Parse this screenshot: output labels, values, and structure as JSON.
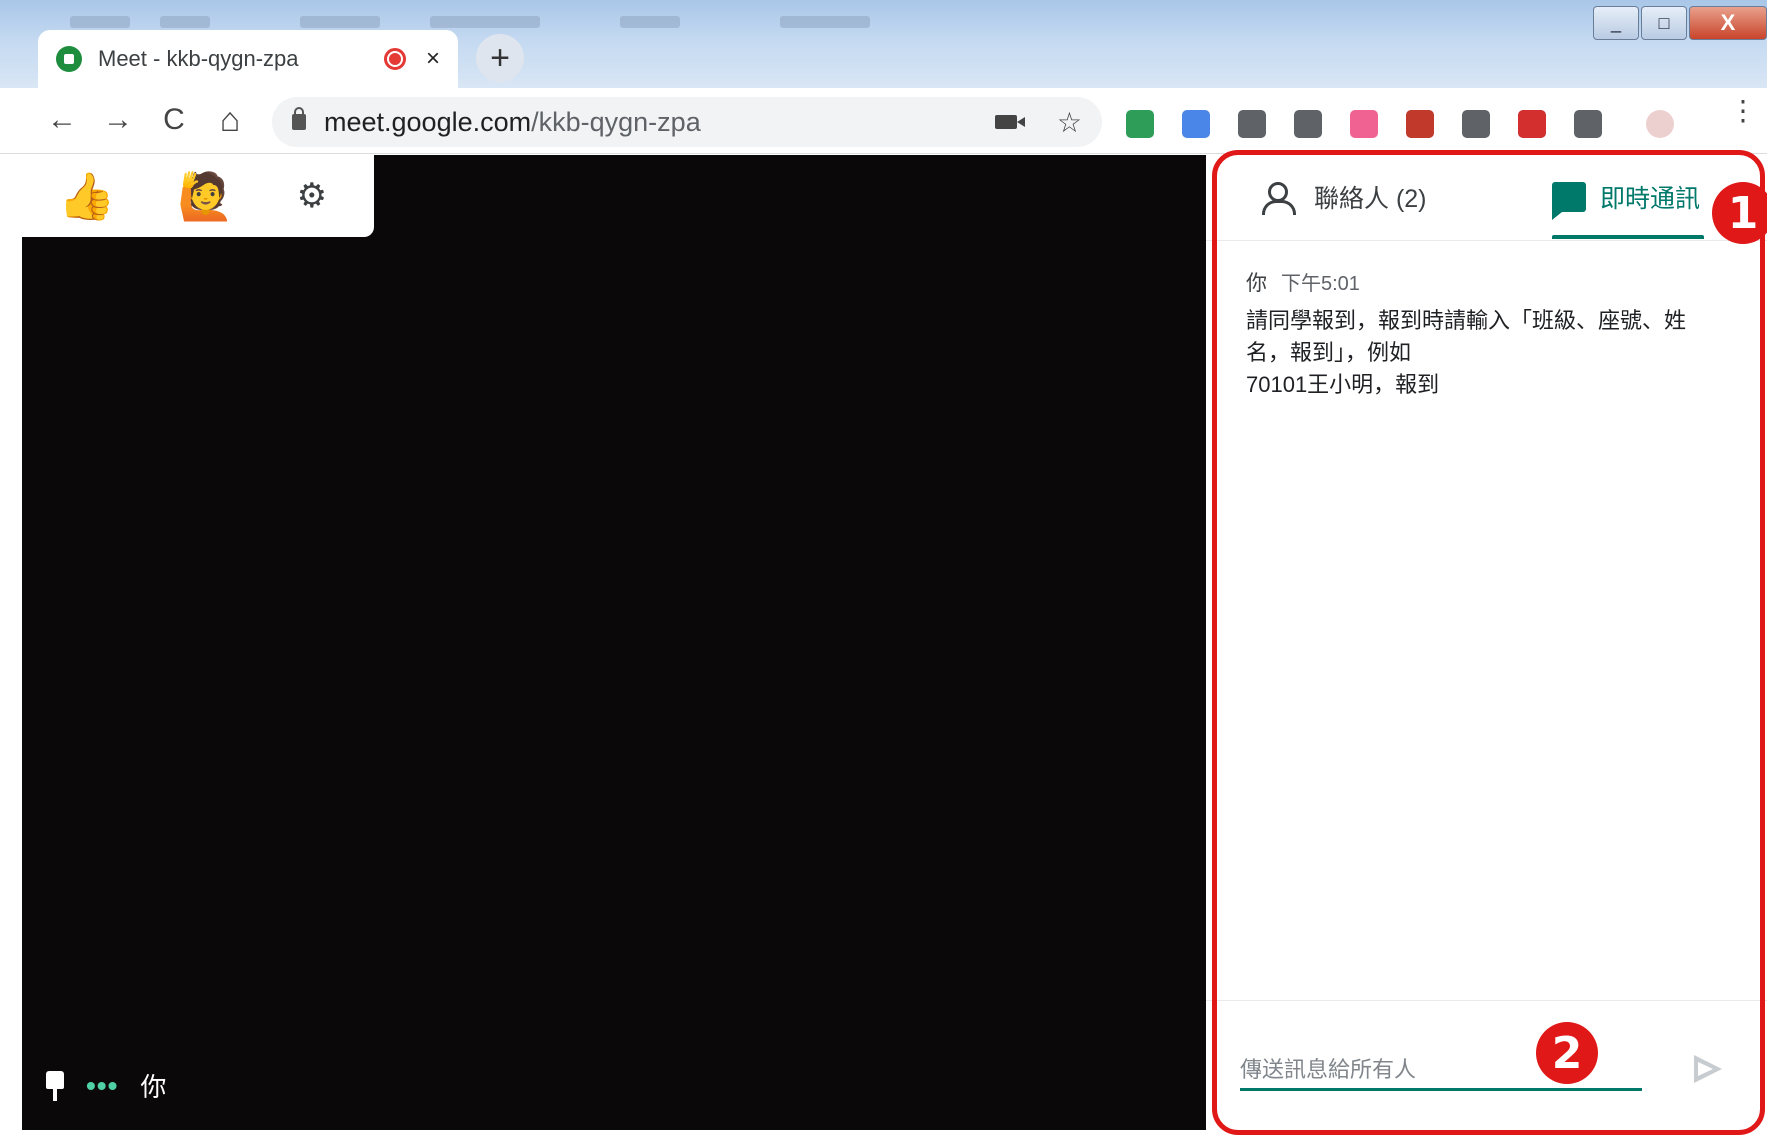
{
  "browser": {
    "tab_title": "Meet - kkb-qygn-zpa",
    "tab_close": "×",
    "new_tab": "+",
    "url_host": "meet.google.com",
    "url_path": "/kkb-qygn-zpa",
    "back": "←",
    "forward": "→",
    "reload": "C",
    "home": "⌂",
    "star": "☆",
    "menu": "⋮",
    "window_buttons": {
      "minimize": "_",
      "maximize": "□",
      "close": "X"
    },
    "extensions": [
      {
        "name": "classroom-icon",
        "color": "#2e9d57"
      },
      {
        "name": "translate-icon",
        "color": "#4a86e8"
      },
      {
        "name": "camera-icon",
        "color": "#5f6368"
      },
      {
        "name": "bulb-icon",
        "color": "#5f6368"
      },
      {
        "name": "arrow-ext-icon",
        "color": "#f06292"
      },
      {
        "name": "pdf-icon",
        "color": "#c0392b"
      },
      {
        "name": "cast-icon",
        "color": "#5f6368"
      },
      {
        "name": "apple-icon",
        "color": "#d32f2f"
      },
      {
        "name": "grid-icon",
        "color": "#5f6368"
      },
      {
        "name": "profile-icon",
        "color": "#e0b0b0"
      }
    ]
  },
  "meet": {
    "reactions": {
      "thumbs": "👍",
      "raise_hand": "🙋"
    },
    "settings_icon": "⚙",
    "self_name": "你",
    "self_dots": "•••"
  },
  "panel": {
    "people_tab": "聯絡人 (2)",
    "chat_tab": "即時通訊",
    "message": {
      "sender": "你",
      "time": "下午5:01",
      "lines": [
        "請同學報到，報到時請輸入「班級、座號、姓",
        "名，報到」，例如",
        "70101王小明，報到"
      ]
    },
    "composer_placeholder": "傳送訊息給所有人"
  },
  "annotations": {
    "badge1": "1",
    "badge2": "2",
    "color": "#e01818"
  },
  "colors": {
    "accent": "#00796b",
    "video_bg": "#0a0808"
  }
}
